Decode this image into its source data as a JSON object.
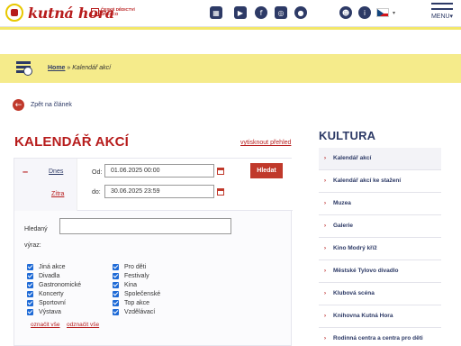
{
  "header": {
    "logo_text": "kutná hora",
    "unesco_text": "ČESKÉ DĚDICTVÍ UNESCO",
    "icons": [
      "calendar-icon",
      "youtube-icon",
      "facebook-icon",
      "instagram-icon",
      "tripadvisor-icon",
      "user-icon",
      "info-icon"
    ],
    "menu_label": "MENU▾"
  },
  "breadcrumb": {
    "home": "Home",
    "separator": "»",
    "current": "Kalendář akcí"
  },
  "back_link": "Zpět na článek",
  "page_title": "KALENDÁŘ AKCÍ",
  "print_link": "vytisknout přehled",
  "filter": {
    "collapse_symbol": "–",
    "tab_today": "Dnes",
    "tab_tomorrow": "Zítra",
    "from_label": "Od:",
    "to_label": "do:",
    "from_value": "01.06.2025 00:00",
    "to_value": "30.06.2025 23:59",
    "search_button": "Hledat",
    "query_label": "Hledaný výraz:",
    "query_value": "",
    "categories_left": [
      "Jiná akce",
      "Divadla",
      "Gastronomické",
      "Koncerty",
      "Sportovní",
      "Výstava"
    ],
    "categories_right": [
      "Pro děti",
      "Festivaly",
      "Kina",
      "Společenské",
      "Top akce",
      "Vzdělávací"
    ],
    "select_all": "označit vše",
    "deselect_all": "odznačit vše"
  },
  "sidebar": {
    "title": "KULTURA",
    "items": [
      "Kalendář akcí",
      "Kalendář akcí ke stažení",
      "Muzea",
      "Galerie",
      "Kino Modrý kříž",
      "Městské Tylovo divadlo",
      "Klubová scéna",
      "Knihovna Kutná Hora",
      "Rodinná centra a centra pro děti"
    ]
  },
  "colors": {
    "brand_red": "#b71c1c",
    "navy": "#2d3a66",
    "yellow_band": "#f5eb8b",
    "checkbox_blue": "#1e6ad6"
  }
}
